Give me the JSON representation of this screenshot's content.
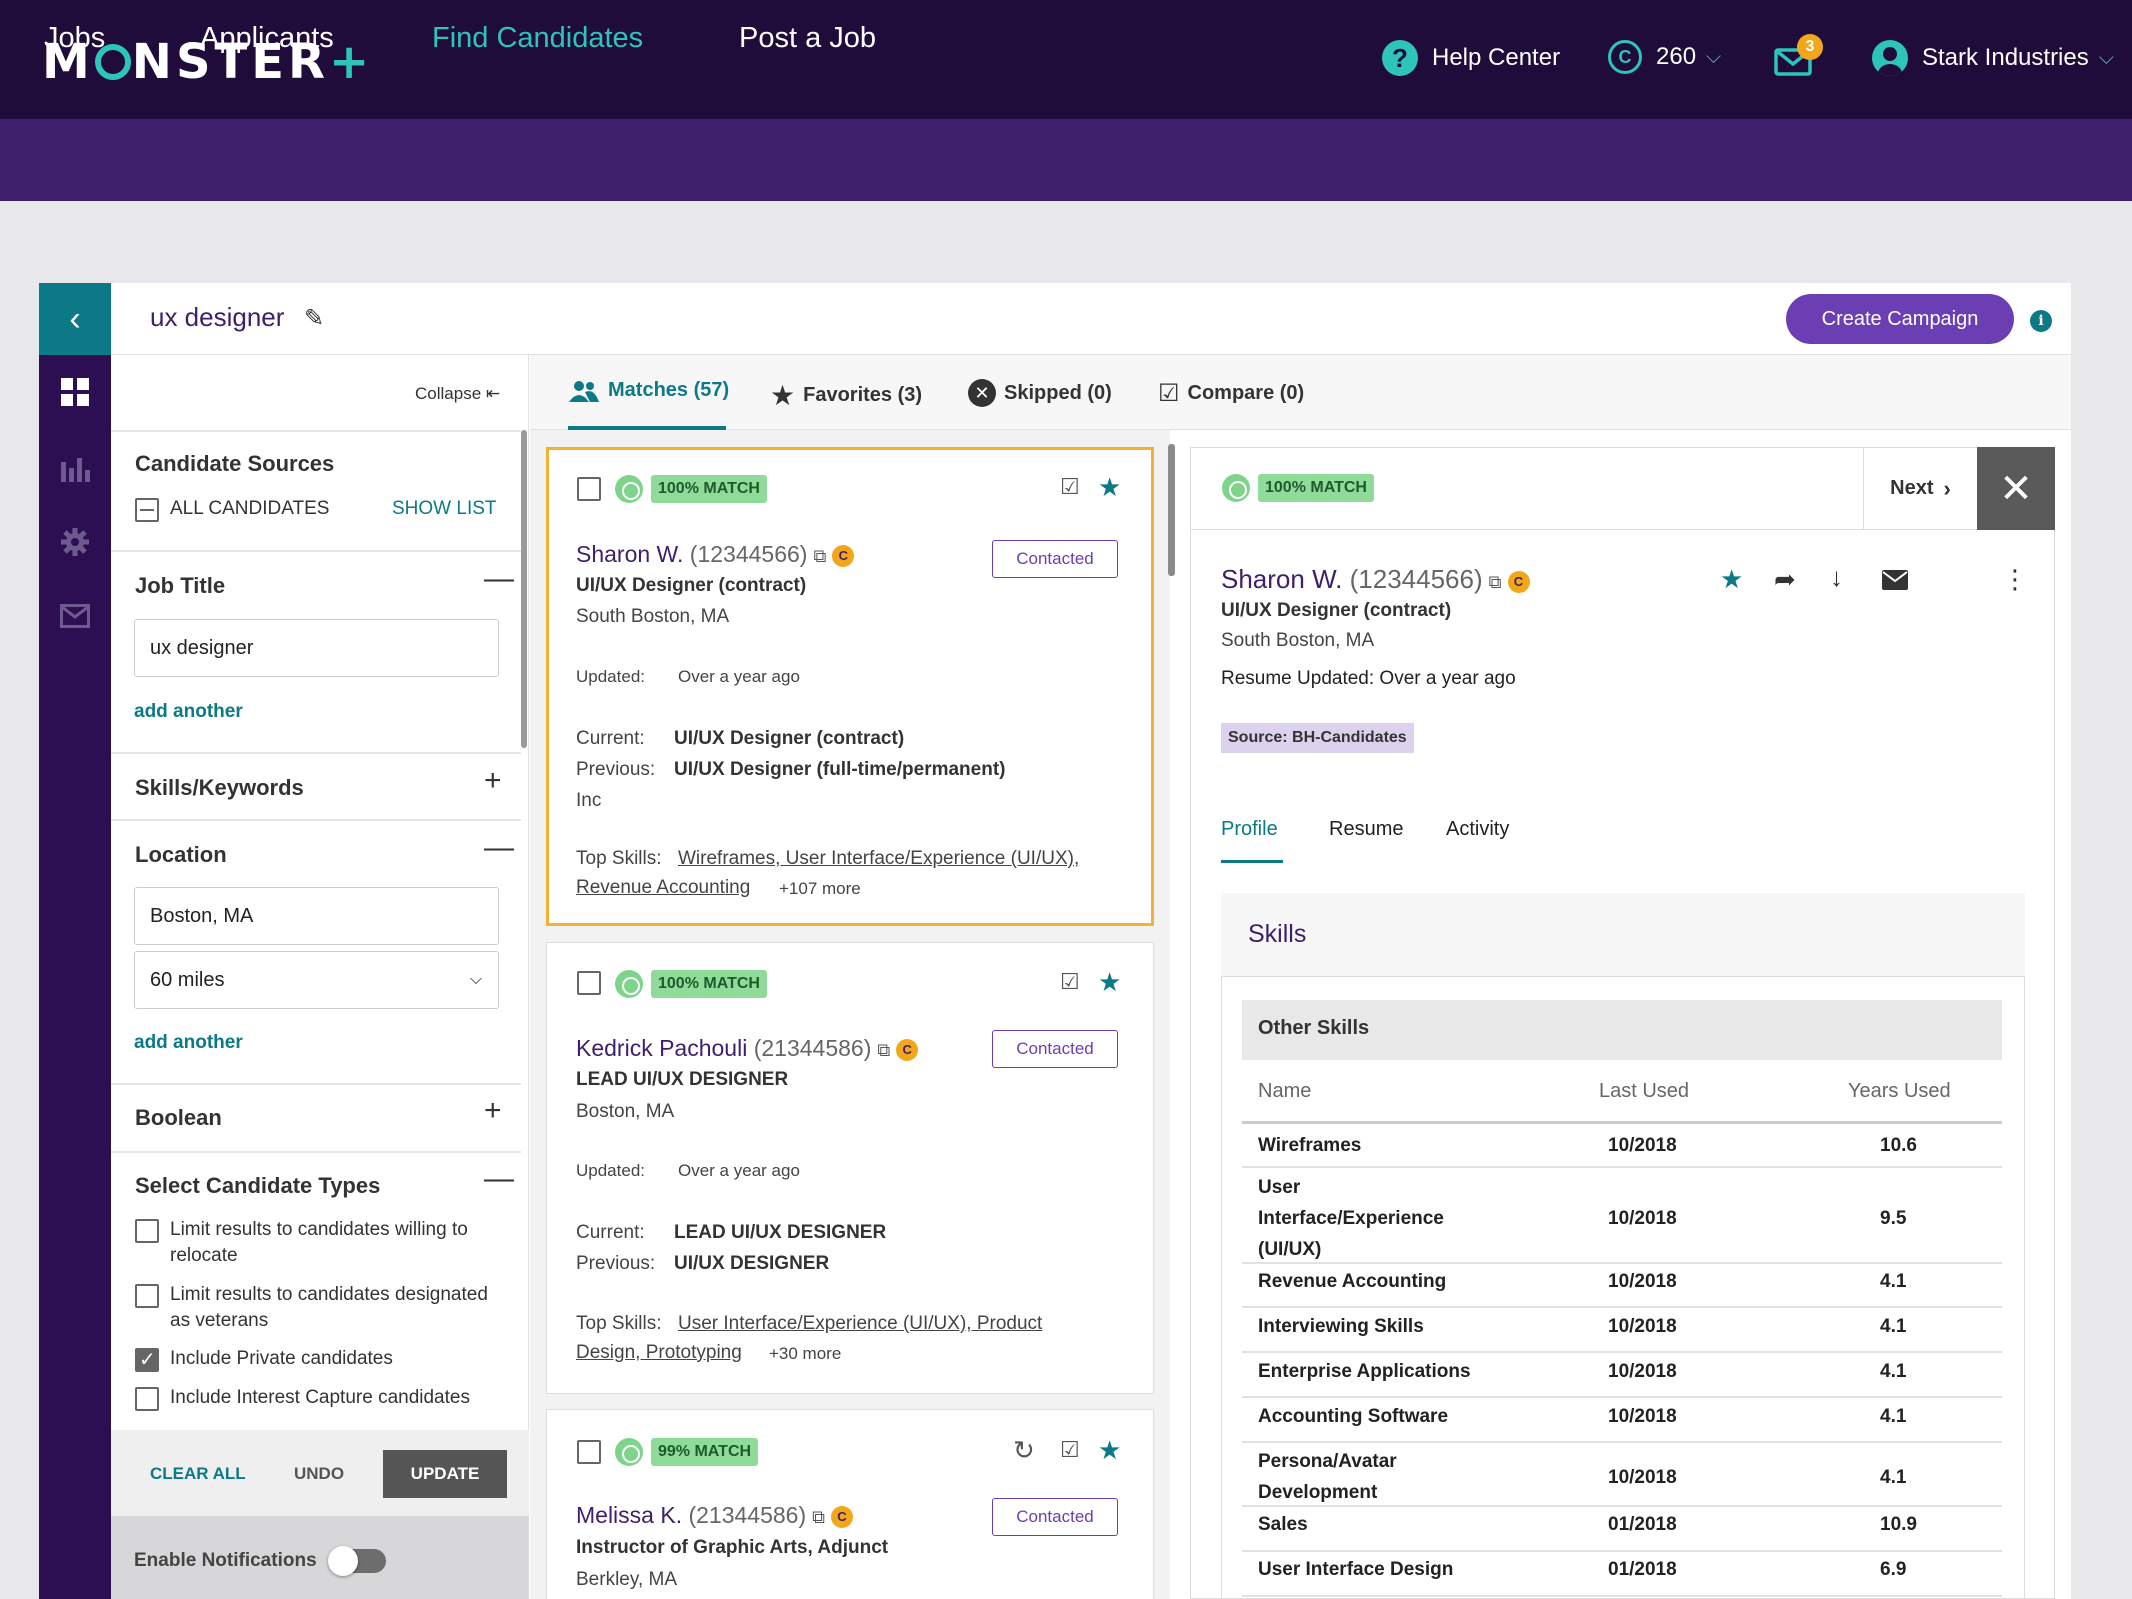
{
  "header": {
    "logo": "MONSTER",
    "help": "Help Center",
    "credits": "260",
    "mail_count": "3",
    "account": "Stark Industries"
  },
  "nav": [
    "Jobs",
    "Applicants",
    "Find Candidates",
    "Post a Job"
  ],
  "search": {
    "query": "ux designer",
    "campaign_button": "Create Campaign"
  },
  "filters": {
    "collapse": "Collapse",
    "sources_title": "Candidate Sources",
    "all_candidates": "ALL CANDIDATES",
    "show_list": "SHOW LIST",
    "job_title": "Job Title",
    "job_title_value": "ux designer",
    "add_another": "add another",
    "skills": "Skills/Keywords",
    "location": "Location",
    "location_value": "Boston, MA",
    "radius": "60 miles",
    "boolean": "Boolean",
    "types_title": "Select Candidate Types",
    "types": [
      {
        "label": "Limit results to candidates willing to relocate",
        "checked": false
      },
      {
        "label": "Limit results to candidates designated as veterans",
        "checked": false
      },
      {
        "label": "Include Private candidates",
        "checked": true
      },
      {
        "label": "Include Interest Capture candidates",
        "checked": false
      }
    ],
    "clear_all": "CLEAR ALL",
    "undo": "UNDO",
    "update": "UPDATE",
    "notifications": "Enable Notifications"
  },
  "tabs": [
    "Matches (57)",
    "Favorites (3)",
    "Skipped (0)",
    "Compare (0)"
  ],
  "cards": [
    {
      "match": "100% MATCH",
      "name": "Sharon W.",
      "id": "(12344566)",
      "badge": "C",
      "title": "UI/UX Designer (contract)",
      "location": "South Boston, MA",
      "updated_label": "Updated:",
      "updated": "Over a year ago",
      "current_label": "Current:",
      "current": "UI/UX Designer (contract)",
      "previous_label": "Previous:",
      "previous": "UI/UX Designer (full-time/permanent)",
      "extra": "Inc",
      "skills_label": "Top Skills:",
      "skills_1": "Wireframes, User Interface/Experience (UI/UX),",
      "skills_2": "Revenue Accounting",
      "more": "+107 more",
      "status": "Contacted"
    },
    {
      "match": "100% MATCH",
      "name": "Kedrick Pachouli",
      "id": "(21344586)",
      "badge": "C",
      "title": "LEAD UI/UX DESIGNER",
      "location": "Boston, MA",
      "updated_label": "Updated:",
      "updated": "Over a year ago",
      "current_label": "Current:",
      "current": "LEAD UI/UX DESIGNER",
      "previous_label": "Previous:",
      "previous": "UI/UX DESIGNER",
      "skills_label": "Top Skills:",
      "skills_1": "User Interface/Experience (UI/UX), Product",
      "skills_2": "Design, Prototyping",
      "more": "+30 more",
      "status": "Contacted"
    },
    {
      "match": "99% MATCH",
      "name": "Melissa K.",
      "id": "(21344586)",
      "badge": "C",
      "title": "Instructor of Graphic Arts, Adjunct",
      "location": "Berkley, MA",
      "status": "Contacted"
    }
  ],
  "detail": {
    "match": "100% MATCH",
    "next": "Next",
    "name": "Sharon W.",
    "id": "(12344566)",
    "badge": "C",
    "title": "UI/UX Designer (contract)",
    "location": "South Boston, MA",
    "resume_updated": "Resume Updated: Over a year ago",
    "source": "Source: BH-Candidates",
    "tabs": [
      "Profile",
      "Resume",
      "Activity"
    ],
    "skills_title": "Skills",
    "other_skills": "Other Skills",
    "columns": [
      "Name",
      "Last Used",
      "Years Used"
    ],
    "rows": [
      {
        "name": "Wireframes",
        "last": "10/2018",
        "years": "10.6"
      },
      {
        "name": "User Interface/Experience (UI/UX)",
        "last": "10/2018",
        "years": "9.5"
      },
      {
        "name": "Revenue Accounting",
        "last": "10/2018",
        "years": "4.1"
      },
      {
        "name": "Interviewing Skills",
        "last": "10/2018",
        "years": "4.1"
      },
      {
        "name": "Enterprise Applications",
        "last": "10/2018",
        "years": "4.1"
      },
      {
        "name": "Accounting Software",
        "last": "10/2018",
        "years": "4.1"
      },
      {
        "name": "Persona/Avatar Development",
        "last": "10/2018",
        "years": "4.1"
      },
      {
        "name": "Sales",
        "last": "01/2018",
        "years": "10.9"
      },
      {
        "name": "User Interface Design",
        "last": "01/2018",
        "years": "6.9"
      }
    ]
  },
  "colors": {
    "header_bg": "#1f0c3b",
    "nav_bg": "#3e1f6c",
    "accent": "#2cc5b8",
    "teal": "#0b7a86",
    "purple": "#6b3fb3",
    "highlight": "#f2b233"
  }
}
